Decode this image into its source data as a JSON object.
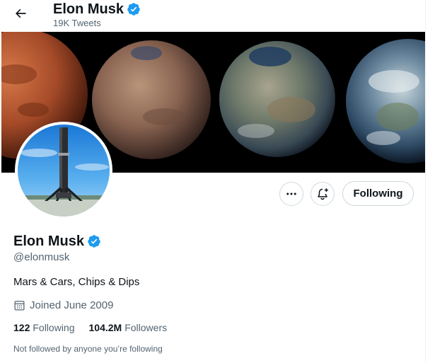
{
  "header": {
    "title": "Elon Musk",
    "tweet_count": "19K Tweets"
  },
  "profile": {
    "name": "Elon Musk",
    "handle": "@elonmusk",
    "bio": "Mars & Cars, Chips & Dips",
    "joined": "Joined June 2009",
    "following_count": "122",
    "following_label": "Following",
    "followers_count": "104.2M",
    "followers_label": "Followers",
    "not_followed_note": "Not followed by anyone you’re following"
  },
  "actions": {
    "more_icon": "more-icon",
    "notify_icon": "bell-plus-icon",
    "follow_label": "Following"
  },
  "colors": {
    "verified": "#1d9bf0",
    "text_primary": "#0f1419",
    "text_secondary": "#536471",
    "border": "#cfd9de"
  }
}
